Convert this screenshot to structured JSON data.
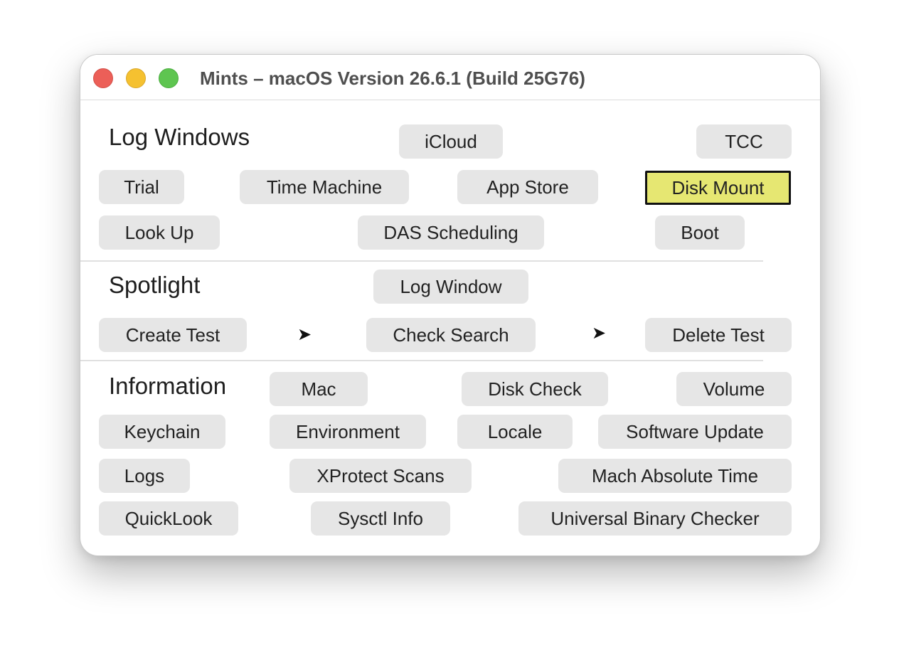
{
  "window": {
    "title": "Mints – macOS Version 26.6.1 (Build 25G76)"
  },
  "log_windows": {
    "title": "Log Windows",
    "buttons": [
      "iCloud",
      "TCC",
      "Trial",
      "Time Machine",
      "App Store",
      "Disk Mount",
      "Look Up",
      "DAS Scheduling",
      "Boot"
    ]
  },
  "spotlight": {
    "title": "Spotlight",
    "buttons": [
      "Log Window",
      "Create Test",
      "Check Search",
      "Delete Test"
    ],
    "arrow_glyph": "➤"
  },
  "information": {
    "title": "Information",
    "buttons": [
      "Mac",
      "Disk Check",
      "Volume",
      "Keychain",
      "Environment",
      "Locale",
      "Software Update",
      "Logs",
      "XProtect Scans",
      "Mach Absolute Time",
      "QuickLook",
      "Sysctl Info",
      "Universal Binary Checker"
    ]
  },
  "colors": {
    "highlight": "#e6e772",
    "button_bg": "#e6e6e6",
    "close": "#ec5f58",
    "minimize": "#f5c130",
    "maximize": "#5ec550"
  }
}
